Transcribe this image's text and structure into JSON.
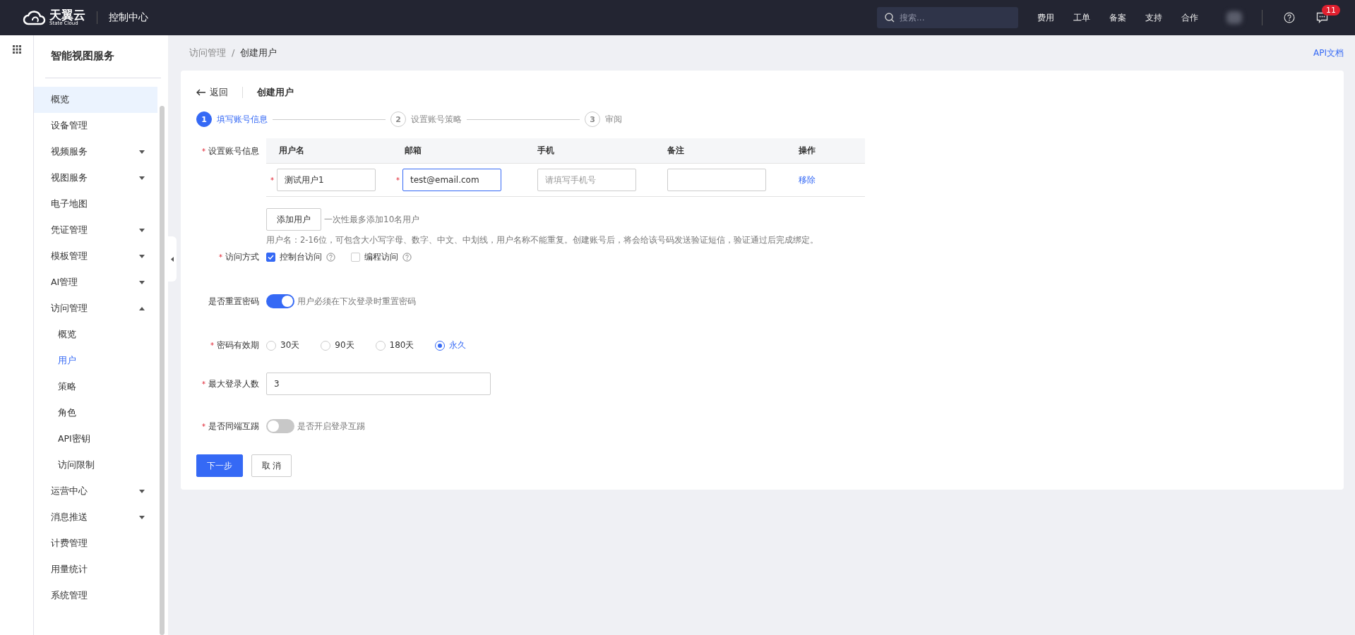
{
  "topbar": {
    "logo_name": "天翼云",
    "logo_sub": "State Cloud",
    "console": "控制中心",
    "search": {
      "placeholder": "搜索..."
    },
    "nav": [
      "费用",
      "工单",
      "备案",
      "支持",
      "合作"
    ],
    "notification_count": "11"
  },
  "sidebar": {
    "title": "智能视图服务",
    "items": [
      {
        "label": "概览",
        "kind": "link",
        "selected": true
      },
      {
        "label": "设备管理",
        "kind": "link",
        "selected": false
      },
      {
        "label": "视频服务",
        "kind": "group",
        "selected": false,
        "expanded": false
      },
      {
        "label": "视图服务",
        "kind": "group",
        "selected": false,
        "expanded": false
      },
      {
        "label": "电子地图",
        "kind": "link",
        "selected": false
      },
      {
        "label": "凭证管理",
        "kind": "group",
        "selected": false,
        "expanded": false
      },
      {
        "label": "模板管理",
        "kind": "group",
        "selected": false,
        "expanded": false
      },
      {
        "label": "AI管理",
        "kind": "group",
        "selected": false,
        "expanded": false
      },
      {
        "label": "访问管理",
        "kind": "group",
        "selected": false,
        "expanded": true,
        "children": [
          {
            "label": "概览",
            "selected": false
          },
          {
            "label": "用户",
            "selected": true
          },
          {
            "label": "策略",
            "selected": false
          },
          {
            "label": "角色",
            "selected": false
          },
          {
            "label": "API密钥",
            "selected": false
          },
          {
            "label": "访问限制",
            "selected": false
          }
        ]
      },
      {
        "label": "运营中心",
        "kind": "group",
        "selected": false,
        "expanded": false
      },
      {
        "label": "消息推送",
        "kind": "group",
        "selected": false,
        "expanded": false
      },
      {
        "label": "计费管理",
        "kind": "link",
        "selected": false
      },
      {
        "label": "用量统计",
        "kind": "link",
        "selected": false
      },
      {
        "label": "系统管理",
        "kind": "link",
        "selected": false
      }
    ]
  },
  "breadcrumb": {
    "items": [
      "访问管理",
      "创建用户"
    ],
    "separator": "/"
  },
  "api_doc_link": "API文档",
  "header": {
    "back": "返回",
    "title": "创建用户"
  },
  "steps": [
    {
      "number": "1",
      "label": "填写账号信息",
      "active": true
    },
    {
      "number": "2",
      "label": "设置账号策略",
      "active": false
    },
    {
      "number": "3",
      "label": "审阅",
      "active": false
    }
  ],
  "form": {
    "account": {
      "label": "设置账号信息",
      "required_mark": "*",
      "columns": [
        "用户名",
        "邮箱",
        "手机",
        "备注",
        "操作"
      ],
      "rows": [
        {
          "username": {
            "value": "测试用户1",
            "required_mark": "*",
            "focused": false
          },
          "email": {
            "value": "test@email.com",
            "required_mark": "*",
            "focused": true
          },
          "phone": {
            "placeholder": "请填写手机号",
            "focused": false
          },
          "note": {
            "focused": false
          },
          "action": "移除"
        }
      ],
      "add_button": "添加用户",
      "add_hint": "一次性最多添加10名用户",
      "rules_hint": "用户名：2-16位，可包含大小写字母、数字、中文、中划线，用户名称不能重复。创建账号后，将会给该号码发送验证短信，验证通过后完成绑定。"
    },
    "access": {
      "label": "访问方式",
      "required_mark": "*",
      "options": [
        {
          "label": "控制台访问",
          "checked": true
        },
        {
          "label": "编程访问",
          "checked": false
        }
      ]
    },
    "reset_password": {
      "label": "是否重置密码",
      "on": true,
      "hint": "用户必须在下次登录时重置密码"
    },
    "validity": {
      "label": "密码有效期",
      "required_mark": "*",
      "options": [
        {
          "label": "30天",
          "selected": false
        },
        {
          "label": "90天",
          "selected": false
        },
        {
          "label": "180天",
          "selected": false
        },
        {
          "label": "永久",
          "selected": true
        }
      ]
    },
    "max_login": {
      "label": "最大登录人数",
      "required_mark": "*",
      "value": "3"
    },
    "kick": {
      "label": "是否同端互踢",
      "required_mark": "*",
      "on": false,
      "hint": "是否开启登录互踢"
    }
  },
  "buttons": [
    {
      "label": "下一步",
      "kind": "primary"
    },
    {
      "label": "取 消",
      "kind": "default"
    }
  ]
}
